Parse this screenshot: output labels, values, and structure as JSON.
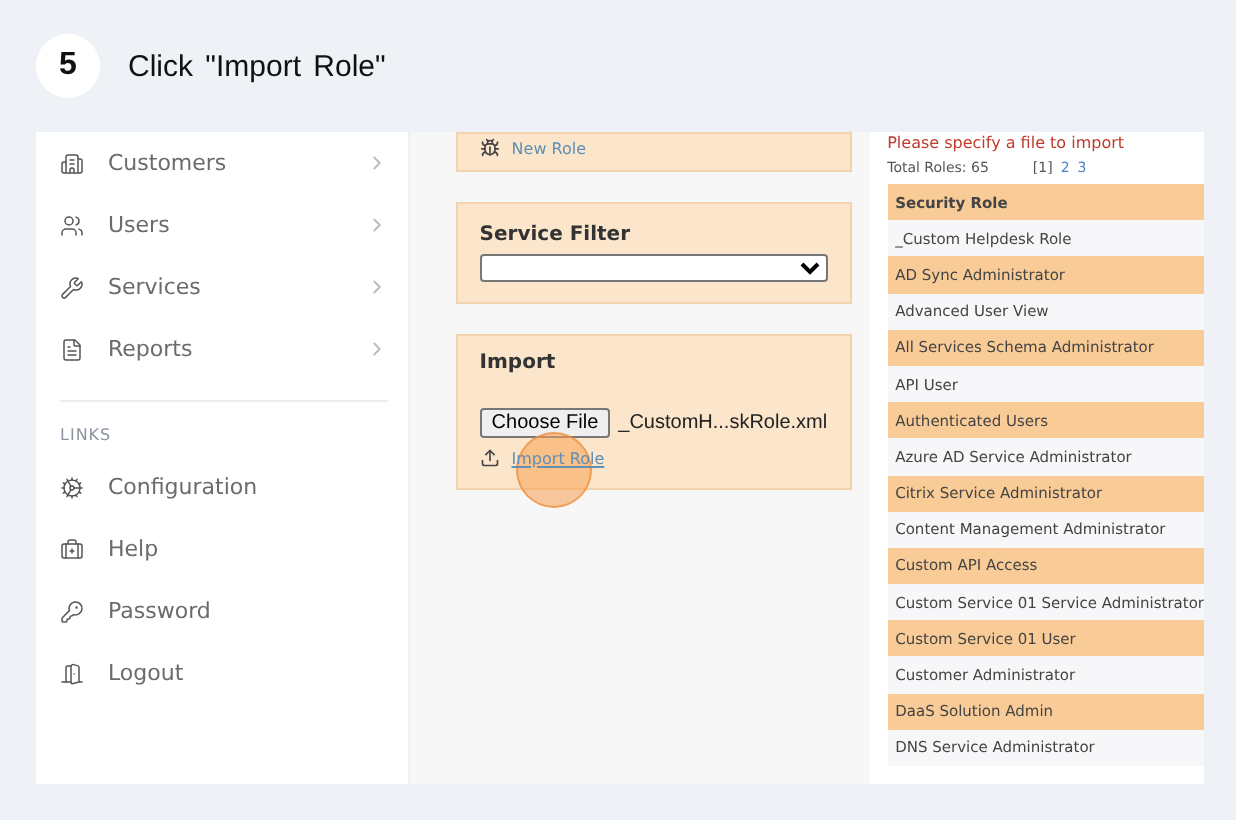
{
  "step": {
    "number": "5",
    "instruction": "Click \"Import Role\""
  },
  "sidebar": {
    "items": [
      {
        "label": "Customers"
      },
      {
        "label": "Users"
      },
      {
        "label": "Services"
      },
      {
        "label": "Reports"
      }
    ],
    "links_heading": "LINKS",
    "links": [
      {
        "label": "Configuration"
      },
      {
        "label": "Help"
      },
      {
        "label": "Password"
      },
      {
        "label": "Logout"
      }
    ]
  },
  "new_role": {
    "label": "New Role"
  },
  "service_filter": {
    "title": "Service Filter"
  },
  "import": {
    "title": "Import",
    "choose_button": "Choose File",
    "file_name": "_CustomH...skRole.xml",
    "action": "Import Role",
    "clicked": true
  },
  "roles": {
    "error": "Please specify a file to import",
    "total": "Total Roles:  65",
    "pages": [
      {
        "label": "[1]",
        "selected": true
      },
      {
        "label": "2",
        "selected": false
      },
      {
        "label": "3",
        "selected": false
      }
    ],
    "header": "Security Role",
    "rows": [
      "_Custom Helpdesk Role",
      "AD Sync Administrator",
      "Advanced User View",
      "All Services Schema Administrator",
      "API User",
      "Authenticated Users",
      "Azure AD Service Administrator",
      "Citrix Service Administrator",
      "Content Management Administrator",
      "Custom API Access",
      "Custom Service 01 Service Administrator",
      "Custom Service 01 User",
      "Customer Administrator",
      "DaaS Solution Admin",
      "DNS Service Administrator"
    ]
  }
}
